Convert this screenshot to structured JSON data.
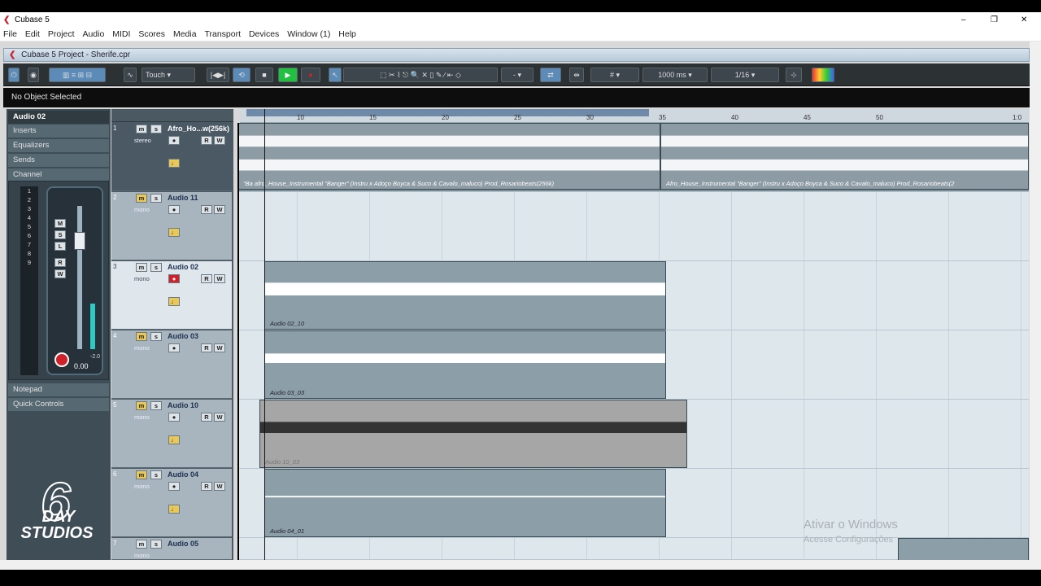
{
  "window": {
    "title": "Cubase 5",
    "min": "–",
    "max": "❐",
    "close": "✕"
  },
  "menu": [
    "File",
    "Edit",
    "Project",
    "Audio",
    "MIDI",
    "Scores",
    "Media",
    "Transport",
    "Devices",
    "Window (1)",
    "Help"
  ],
  "project": {
    "title": "Cubase 5 Project - Sherife.cpr"
  },
  "toolbar": {
    "automation_mode": "Touch",
    "nudge": "-",
    "grid_value": "1000 ms",
    "quantize": "1/16"
  },
  "info_line": "No Object Selected",
  "inspector": {
    "track_name": "Audio 02",
    "sections": [
      "Inserts",
      "Equalizers",
      "Sends",
      "Channel"
    ],
    "fader_value": "0.00",
    "meter_value": "-2.0",
    "bottom_sections": [
      "Notepad",
      "Quick Controls"
    ],
    "strip_buttons": [
      "M",
      "S",
      "L",
      "R",
      "W"
    ],
    "scale": [
      "1",
      "2",
      "3",
      "4",
      "5",
      "6",
      "7",
      "8",
      "9"
    ]
  },
  "ruler": {
    "ticks": [
      "10",
      "15",
      "20",
      "25",
      "30",
      "35",
      "40",
      "45",
      "50",
      "1:0"
    ]
  },
  "tracks": [
    {
      "num": "1",
      "name": "Afro_Ho...w(256k)",
      "sub": "stereo"
    },
    {
      "num": "2",
      "name": "Audio 11",
      "sub": "mono"
    },
    {
      "num": "3",
      "name": "Audio 02",
      "sub": "mono"
    },
    {
      "num": "4",
      "name": "Audio 03",
      "sub": "mono"
    },
    {
      "num": "5",
      "name": "Audio 10",
      "sub": "mono"
    },
    {
      "num": "6",
      "name": "Audio 04",
      "sub": "mono"
    },
    {
      "num": "7",
      "name": "Audio 05",
      "sub": "mono"
    }
  ],
  "clips": {
    "t1a": "\"Ba  afro_House_Instrumental \"Banger\"  (Instru x Adoço Boyca & Suco & Cavalo_maluco)  Prod_Rosariobeats(256k)",
    "t1b": "Afro_House_Instrumental \"Banger\"  (Instru x Adoço Boyca & Suco & Cavalo_maluco)  Prod_Rosariobeats(2",
    "t3": "Audio 02_10",
    "t4": "Audio 03_03",
    "t5": "Audio 10_03",
    "t6": "Audio 04_01"
  },
  "watermark": {
    "line1": "Ativar o Windows",
    "line2": "Acesse Configurações"
  },
  "logo": {
    "line1": "DAY",
    "line2": "STUDIOS",
    "digit": "6"
  },
  "colors": {
    "accent": "#5c8bb8",
    "selected_track": "#dfe7ec",
    "record": "#d0202a",
    "play": "#22c040"
  }
}
